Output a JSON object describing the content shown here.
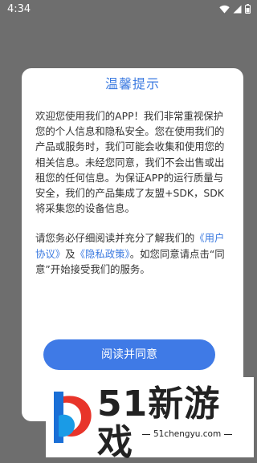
{
  "status_bar": {
    "time": "4:34"
  },
  "dialog": {
    "title": "温馨提示",
    "paragraph1": "欢迎您使用我们的APP！我们非常重视保护您的个人信息和隐私安全。您在使用我们的产品或服务时，我们可能会收集和使用您的相关信息。未经您同意，我们不会出售或出租您的任何信息。为保证APP的运行质量与安全，我们的产品集成了友盟+SDK，SDK将采集您的设备信息。",
    "paragraph2_prefix": "请您务必仔细阅读并充分了解我们的",
    "user_agreement_link": "《用户协议》",
    "and_text": "及",
    "privacy_policy_link": "《隐私政策》",
    "paragraph2_suffix": "。如您同意请点击“同意”开始接受我们的服务。",
    "agree_button": "阅读并同意"
  },
  "watermark": {
    "brand": "51新游戏",
    "url": "51chengyu.com"
  },
  "colors": {
    "accent": "#3b7ae0",
    "overlay": "#6e6e6e"
  }
}
